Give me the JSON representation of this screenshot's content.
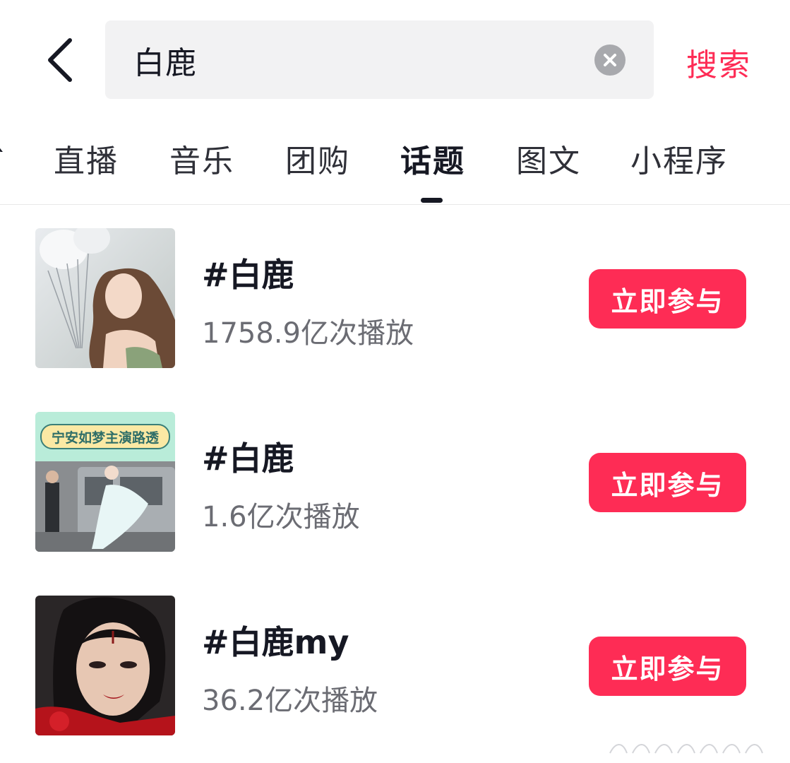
{
  "header": {
    "back_icon": "chevron-left-icon",
    "search_value": "白鹿",
    "clear_icon": "clear-circle-icon",
    "search_button": "搜索"
  },
  "tabs": {
    "items": [
      {
        "label": "直播"
      },
      {
        "label": "音乐"
      },
      {
        "label": "团购"
      },
      {
        "label": "话题",
        "active": true
      },
      {
        "label": "图文"
      },
      {
        "label": "小程序"
      }
    ]
  },
  "results": [
    {
      "title": "#白鹿",
      "plays": "1758.9亿次播放",
      "button": "立即参与"
    },
    {
      "title": "#白鹿",
      "plays": "1.6亿次播放",
      "thumb_caption": "宁安如梦主演路透",
      "button": "立即参与"
    },
    {
      "title": "#白鹿my",
      "plays": "36.2亿次播放",
      "button": "立即参与"
    }
  ],
  "colors": {
    "accent": "#fe2c55",
    "text": "#161823",
    "subtext": "#6b6c73",
    "search_bg": "#f2f2f3"
  }
}
